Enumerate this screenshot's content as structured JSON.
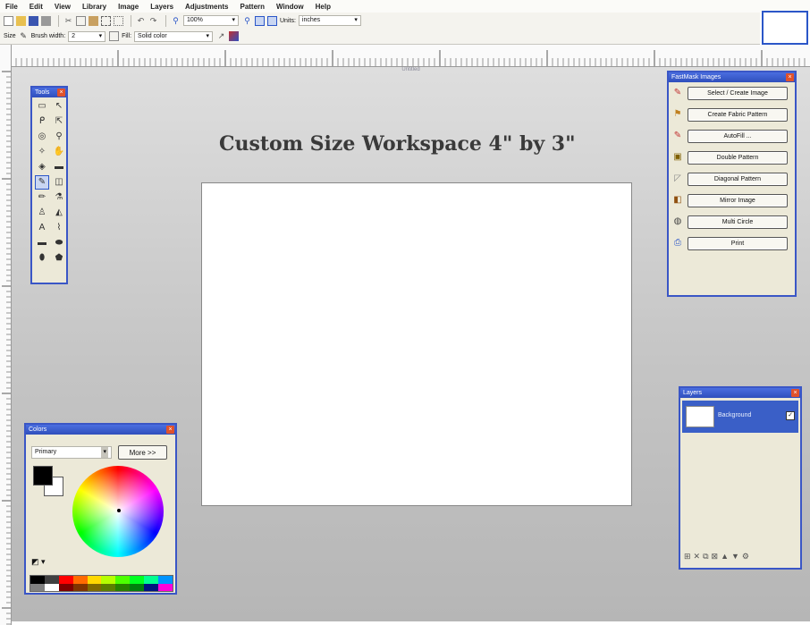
{
  "menu": [
    "File",
    "Edit",
    "View",
    "Library",
    "Image",
    "Layers",
    "Adjustments",
    "Pattern",
    "Window",
    "Help"
  ],
  "toolbar": {
    "zoom": "100%",
    "units": "inches",
    "tool_label": "Size",
    "brush_width_label": "Brush width:",
    "brush_width_value": "2",
    "fill_label": "Fill:",
    "fill_value": "Solid color"
  },
  "workspace": {
    "image_title": "Untitled",
    "heading": "Custom Size Workspace 4\" by 3\""
  },
  "tools": {
    "title": "Tools"
  },
  "fastmask": {
    "title": "FastMask Images",
    "buttons": [
      "Select / Create Image",
      "Create Fabric Pattern",
      "AutoFill ...",
      "Double Pattern",
      "Diagonal Pattern",
      "Mirror Image",
      "Multi Circle",
      "Print"
    ]
  },
  "colors": {
    "title": "Colors",
    "mode": "Primary",
    "more_button": "More >>",
    "primary": "#000000",
    "secondary": "#ffffff",
    "palette": [
      "#000000",
      "#404040",
      "#ff0000",
      "#ff6a00",
      "#ffd800",
      "#b6ff00",
      "#4cff00",
      "#00ff21",
      "#00ff90",
      "#0094ff",
      "#808080",
      "#ffffff",
      "#7f0000",
      "#7f3300",
      "#7f6a00",
      "#5b7f00",
      "#267f00",
      "#007f0e",
      "#00137f",
      "#ff00dc"
    ]
  },
  "layers": {
    "title": "Layers",
    "items": [
      {
        "name": "Background",
        "visible": true
      }
    ]
  }
}
